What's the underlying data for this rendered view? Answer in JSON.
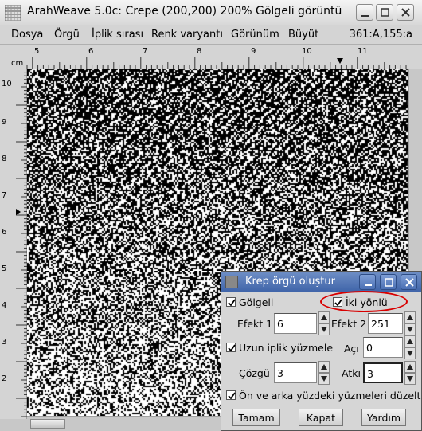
{
  "window": {
    "title": "ArahWeave 5.0c: Crepe (200,200) 200% Gölgeli görüntü"
  },
  "menu": {
    "items": [
      "Dosya",
      "Örgü",
      "İplik sırası",
      "Renk varyantı",
      "Görünüm",
      "Büyüt"
    ],
    "coords": "361:A,155:a"
  },
  "ruler": {
    "unit": "cm",
    "top_labels": [
      "5",
      "6",
      "7",
      "8",
      "9",
      "10",
      "11"
    ],
    "left_labels": [
      "10",
      "9",
      "8",
      "7",
      "6",
      "5",
      "4",
      "3",
      "2"
    ]
  },
  "dialog": {
    "title": "Krep örgü oluştur",
    "golgeli_label": "Gölgeli",
    "golgeli_checked": true,
    "iki_yonlu_label": "İki yönlü",
    "iki_yonlu_checked": true,
    "efekt1_label": "Efekt 1",
    "efekt1_value": "6",
    "efekt2_label": "Efekt 2",
    "efekt2_value": "251",
    "uzun_label": "Uzun iplik yüzmele",
    "uzun_checked": true,
    "aci_label": "Açı",
    "aci_value": "0",
    "cozgu_label": "Çözgü",
    "cozgu_value": "3",
    "atki_label": "Atkı",
    "atki_value": "3",
    "onarka_label": "Ön ve arka yüzdeki yüzmeleri düzelt",
    "onarka_checked": true,
    "ok_label": "Tamam",
    "close_label": "Kapat",
    "help_label": "Yardım"
  },
  "colors": {
    "dialog_title_bg": "#3e63a8",
    "highlight_oval": "#d80000",
    "weave_dark": "#000000",
    "weave_light": "#ffffff"
  }
}
